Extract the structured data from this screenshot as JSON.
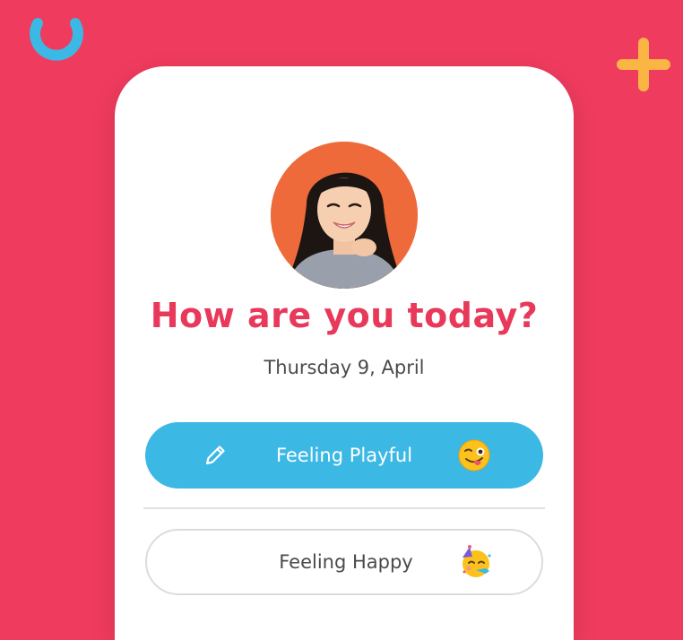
{
  "colors": {
    "background": "#ef3b5e",
    "accent": "#e8395b",
    "selected": "#3cb8e4",
    "ring": "#3cb8e4",
    "plus": "#fbb545"
  },
  "header": {
    "title": "How are you today?",
    "date": "Thursday 9, April"
  },
  "moods": [
    {
      "label": "Feeling Playful",
      "icon": "winking-tongue-emoji",
      "selected": true,
      "action_icon": "pencil-icon"
    },
    {
      "label": "Feeling Happy",
      "icon": "party-face-emoji",
      "selected": false
    }
  ]
}
